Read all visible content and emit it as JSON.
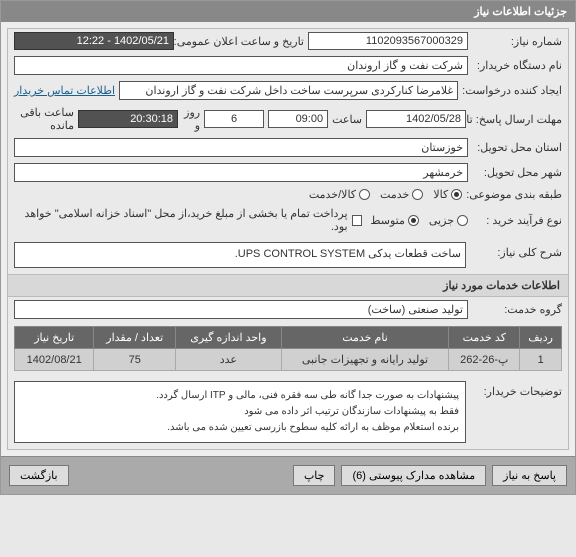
{
  "window": {
    "title": "جزئیات اطلاعات نیاز"
  },
  "fields": {
    "need_no_label": "شماره نیاز:",
    "need_no": "1102093567000329",
    "announce_label": "تاریخ و ساعت اعلان عمومی:",
    "announce_val": "1402/05/21 - 12:22",
    "buyer_label": "نام دستگاه خریدار:",
    "buyer_val": "شرکت نفت و گاز اروندان",
    "creator_label": "ایجاد کننده درخواست:",
    "creator_val": "غلامرضا کنارکردی سرپرست ساخت داخل شرکت نفت و گاز اروندان",
    "contact_link": "اطلاعات تماس خریدار",
    "deadline_label": "مهلت ارسال پاسخ: تا تاریخ:",
    "deadline_date": "1402/05/28",
    "saat1": "ساعت",
    "time_val": "09:00",
    "day_count": "6",
    "roz_va": "روز و",
    "remain_time": "20:30:18",
    "remain_label": "ساعت باقی مانده",
    "province_label": "استان محل تحویل:",
    "province_val": "خوزستان",
    "city_label": "شهر محل تحویل:",
    "city_val": "خرمشهر",
    "category_label": "طبقه بندی موضوعی:",
    "cat_kala": "کالا",
    "cat_khadamat": "خدمت",
    "cat_both": "کالا/خدمت",
    "process_label": "نوع فرآیند خرید :",
    "proc_small": "جزیی",
    "proc_medium": "متوسط",
    "pay_note": "پرداخت تمام یا بخشی از مبلغ خرید،از محل \"اسناد خزانه اسلامی\" خواهد بود.",
    "general_desc_label": "شرح کلی نیاز:",
    "general_desc_val": "ساخت قطعات یدکی UPS CONTROL SYSTEM.",
    "services_section": "اطلاعات خدمات مورد نیاز",
    "service_group_label": "گروه خدمت:",
    "service_group_val": "تولید صنعتی (ساخت)",
    "table": {
      "headers": [
        "ردیف",
        "کد خدمت",
        "نام خدمت",
        "واحد اندازه گیری",
        "تعداد / مقدار",
        "تاریخ نیاز"
      ],
      "rows": [
        {
          "idx": "1",
          "code": "پ-26-262",
          "name": "تولید رایانه و تجهیزات جانبی",
          "unit": "عدد",
          "qty": "75",
          "date": "1402/08/21"
        }
      ]
    },
    "buyer_notes_label": "توضیحات خریدار:",
    "buyer_notes": "پیشنهادات به صورت جدا گانه طی سه فقره فنی، مالی و ITP ارسال گردد.\nفقط به پیشنهادات سازندگان ترتیب اثر داده می شود\nبرنده استعلام موظف به ارائه کلیه سطوح بازرسی تعیین شده می باشد."
  },
  "buttons": {
    "reply": "پاسخ به نیاز",
    "attachments": "مشاهده مدارک پیوستی (6)",
    "print": "چاپ",
    "back": "بازگشت"
  }
}
